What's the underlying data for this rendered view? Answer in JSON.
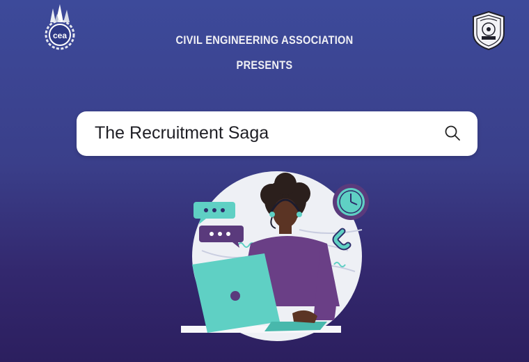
{
  "header": {
    "line1": "CIVIL ENGINEERING ASSOCIATION",
    "line2": "PRESENTS"
  },
  "logos": {
    "left_icon": "cea-logo",
    "left_text": "cea",
    "right_icon": "institute-seal-logo"
  },
  "search": {
    "value": "The Recruitment Saga",
    "icon": "search-icon"
  },
  "illustration": {
    "icon": "woman-headset-laptop-illustration"
  },
  "colors": {
    "background_top": "#3d4a9a",
    "background_bottom": "#2c1f5f",
    "teal": "#5fd0c4",
    "purple": "#6a3f86",
    "search_bg": "#ffffff"
  }
}
